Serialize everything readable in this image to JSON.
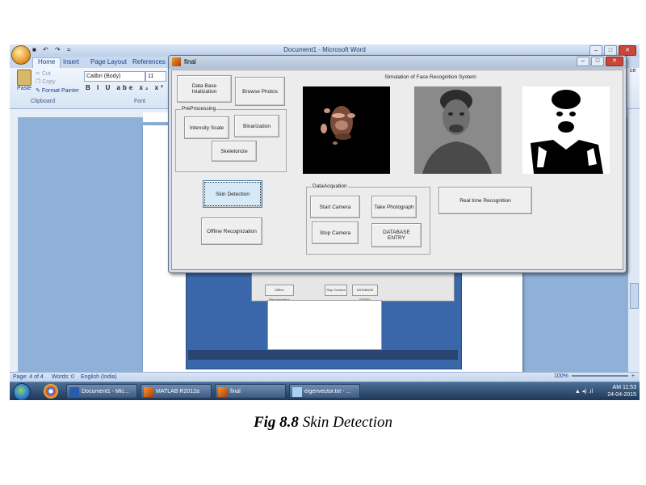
{
  "word": {
    "title": "Document1 - Microsoft Word",
    "qat": "■ ↶ ↷ =",
    "tabs": [
      "Home",
      "Insert",
      "Page Layout",
      "References"
    ],
    "clipboard": {
      "paste": "Paste",
      "cut": "Cut",
      "copy": "Copy",
      "format_painter": "Format Painter",
      "group": "Clipboard"
    },
    "font": {
      "name": "Calibri (Body)",
      "size": "11",
      "group": "Font",
      "formatting": "B I U abe x₂ x² Aa"
    },
    "ribbon_right": "ce",
    "status": {
      "page": "Page: 4 of 4",
      "words": "Words: 0",
      "language": "English (India)",
      "zoom": "100%"
    }
  },
  "taskbar": {
    "items": [
      "Document1 - Mic...",
      "MATLAB R2012a",
      "final",
      "eigenvector.txt - ..."
    ],
    "time": "AM 11:53",
    "date": "24-04-2015"
  },
  "figure": {
    "title": "final",
    "sim_title": "Simulation of Face Recognition System",
    "buttons": {
      "init": "Data Base Inialization",
      "browse": "Browse Photos",
      "intensity": "Intensity Scale",
      "binarization": "Binarization",
      "skeletonize": "Skeletonize",
      "skin": "Skin Detection",
      "offline": "Offline Recognization",
      "start_camera": "Start Camera",
      "take_photo": "Take Photograph",
      "stop_camera": "Stop Camera",
      "db_entry": "DATABASE ENTRY",
      "realtime": "Real time Recognition"
    },
    "panels": {
      "preprocessing": "PreProcessing",
      "acquisition": "DataAcquation"
    }
  },
  "nested": {
    "labels": [
      "Offline Recognization",
      "Stop Camera",
      "DATABASE ENTRY"
    ]
  },
  "caption": {
    "fig": "Fig 8.8",
    "text": " Skin Detection"
  }
}
